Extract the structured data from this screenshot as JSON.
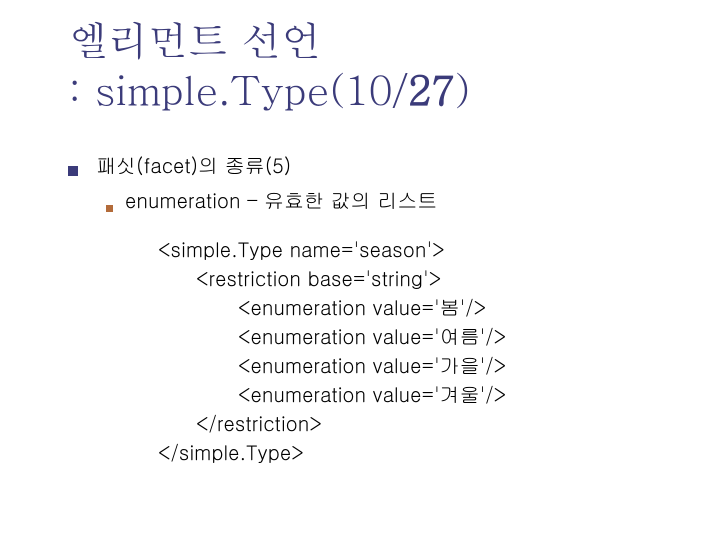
{
  "title": {
    "line1": "엘리먼트 선언",
    "line2_prefix": ": simple.Type(10/",
    "line2_bold": "27",
    "line2_suffix": ")"
  },
  "body": {
    "bullet1": "패싯(facet)의 종류(5)",
    "bullet2": "enumeration – 유효한 값의 리스트"
  },
  "code": {
    "l1": "<simple.Type name='season'>",
    "l2": "<restriction base='string'>",
    "l3": "<enumeration value='봄'/>",
    "l4": "<enumeration value='여름'/>",
    "l5": "<enumeration value='가을'/>",
    "l6": "<enumeration value='겨울'/>",
    "l7": "</restriction>",
    "l8": "</simple.Type>"
  }
}
